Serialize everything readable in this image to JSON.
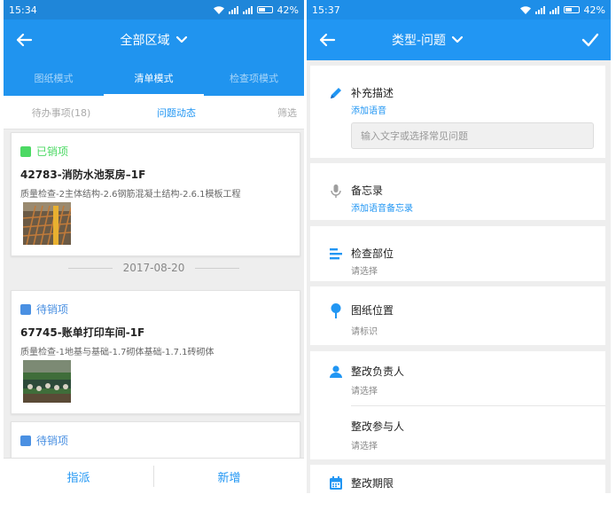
{
  "left": {
    "status_bar": {
      "time": "15:34",
      "battery": "42%"
    },
    "app_bar": {
      "title": "全部区域"
    },
    "mode_tabs": [
      {
        "label": "图纸模式"
      },
      {
        "label": "清单模式"
      },
      {
        "label": "检查项模式"
      }
    ],
    "filter_bar": {
      "todo": "待办事项(18)",
      "activity": "问题动态",
      "filter": "筛选"
    },
    "cards": [
      {
        "status": "已销项",
        "status_color": "#4cd964",
        "title": "42783-消防水池泵房–1F",
        "path": "质量检查-2主体结构-2.6钢筋混凝土结构-2.6.1模板工程"
      },
      {
        "status": "待销项",
        "status_color": "#4a90e2",
        "title": "67745-账单打印车间-1F",
        "path": "质量检查-1地基与基础-1.7砌体基础-1.7.1砖砌体"
      },
      {
        "status": "待销项",
        "status_color": "#4a90e2"
      }
    ],
    "date_separator": "2017-08-20",
    "bottom_bar": {
      "assign": "指派",
      "add": "新增"
    }
  },
  "right": {
    "status_bar": {
      "time": "15:37",
      "battery": "42%"
    },
    "app_bar": {
      "title": "类型-问题"
    },
    "supplement": {
      "label": "补充描述",
      "voice": "添加语音",
      "placeholder": "输入文字或选择常见问题"
    },
    "memo": {
      "label": "备忘录",
      "voice": "添加语音备忘录"
    },
    "inspect_part": {
      "label": "检查部位",
      "value": "请选择"
    },
    "drawing_location": {
      "label": "图纸位置",
      "value": "请标识"
    },
    "rectify_owner": {
      "label": "整改负责人",
      "value": "请选择"
    },
    "rectify_participant": {
      "label": "整改参与人",
      "value": "请选择"
    },
    "rectify_deadline": {
      "label": "整改期限"
    }
  },
  "colors": {
    "accent": "#2196f3",
    "status_bar": "#1f86d9",
    "done_green": "#4cd964",
    "pending_blue": "#4a90e2"
  }
}
